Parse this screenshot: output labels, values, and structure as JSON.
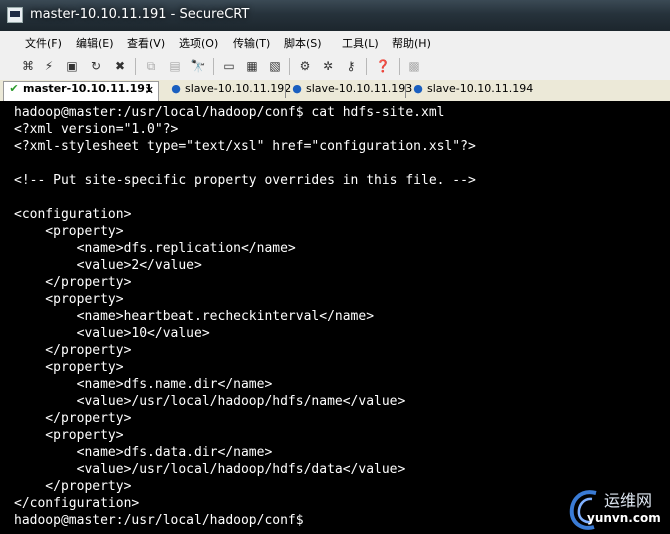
{
  "window": {
    "title": "master-10.10.11.191 - SecureCRT"
  },
  "menu": [
    "文件(F)",
    "编辑(E)",
    "查看(V)",
    "选项(O)",
    "传输(T)",
    "脚本(S)",
    "工具(L)",
    "帮助(H)"
  ],
  "toolbar": {
    "icons": [
      "connect-icon",
      "quick-connect-icon",
      "connect-tab-icon",
      "reconnect-icon",
      "disconnect-icon",
      "copy-icon",
      "paste-icon",
      "find-icon",
      "print-icon",
      "print-setup-icon",
      "print-selection-icon",
      "session-options-icon",
      "global-options-icon",
      "keymap-icon",
      "help-icon",
      "lock-icon"
    ]
  },
  "tabs": [
    {
      "label": "master-10.10.11.191",
      "active": true,
      "status": "connected"
    },
    {
      "label": "slave-10.10.11.192",
      "active": false,
      "status": "info"
    },
    {
      "label": "slave-10.10.11.193",
      "active": false,
      "status": "info"
    },
    {
      "label": "slave-10.10.11.194",
      "active": false,
      "status": "info"
    }
  ],
  "terminal": {
    "lines": [
      "hadoop@master:/usr/local/hadoop/conf$ cat hdfs-site.xml",
      "<?xml version=\"1.0\"?>",
      "<?xml-stylesheet type=\"text/xsl\" href=\"configuration.xsl\"?>",
      "",
      "<!-- Put site-specific property overrides in this file. -->",
      "",
      "<configuration>",
      "    <property>",
      "        <name>dfs.replication</name>",
      "        <value>2</value>",
      "    </property>",
      "    <property>",
      "        <name>heartbeat.recheckinterval</name>",
      "        <value>10</value>",
      "    </property>",
      "    <property>",
      "        <name>dfs.name.dir</name>",
      "        <value>/usr/local/hadoop/hdfs/name</value>",
      "    </property>",
      "    <property>",
      "        <name>dfs.data.dir</name>",
      "        <value>/usr/local/hadoop/hdfs/data</value>",
      "    </property>",
      "</configuration>",
      "hadoop@master:/usr/local/hadoop/conf$"
    ]
  },
  "watermark": {
    "cn": "运维网",
    "en": "yunvn.com"
  }
}
